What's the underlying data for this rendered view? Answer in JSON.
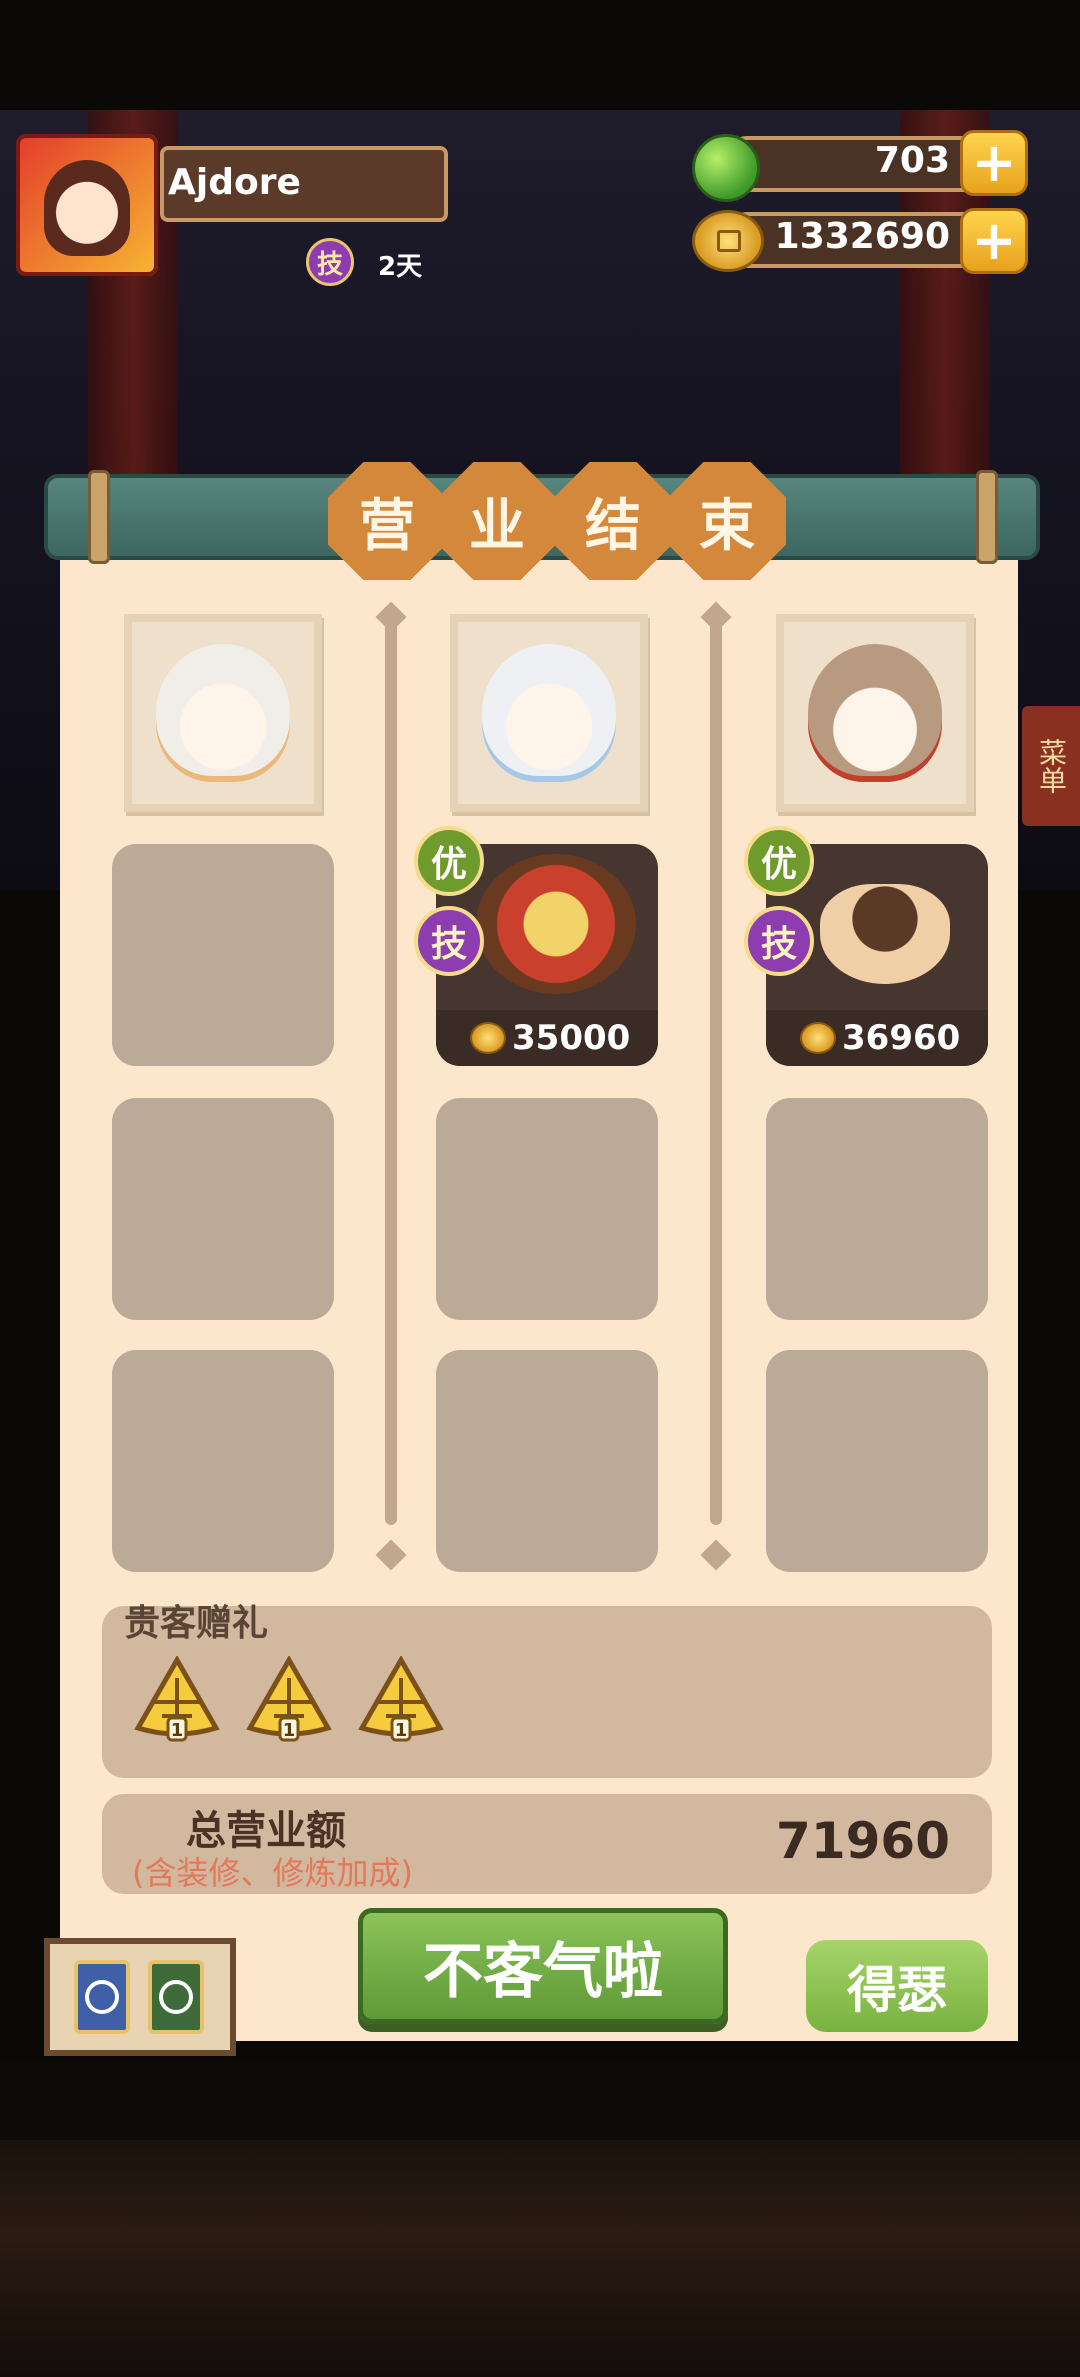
{
  "header": {
    "player_name": "Ajdore",
    "skill_badge": "技",
    "days": "2天",
    "jade_amount": "703",
    "coin_amount": "1332690",
    "plus": "+"
  },
  "title_tiles": [
    "营",
    "业",
    "结",
    "束"
  ],
  "customers": [
    {
      "portrait": "white-haired-girl-gold-crown",
      "slots": [
        null,
        null,
        null,
        null
      ]
    },
    {
      "portrait": "white-haired-girl-blue-bow",
      "slots": [
        {
          "badge_you": "优",
          "badge_ji": "技",
          "price": "35000",
          "dish": "hotpot-dish"
        },
        null,
        null
      ]
    },
    {
      "portrait": "curly-haired-man-glasses",
      "slots": [
        {
          "badge_you": "优",
          "badge_ji": "技",
          "price": "36960",
          "dish": "clay-pot-dish"
        },
        null,
        null
      ]
    }
  ],
  "gift": {
    "title": "贵客赠礼",
    "items": [
      {
        "count": "1"
      },
      {
        "count": "1"
      },
      {
        "count": "1"
      }
    ]
  },
  "total": {
    "label": "总营业额",
    "note": "(含装修、修炼加成)",
    "value": "71960"
  },
  "buttons": {
    "decline": "不客气啦",
    "accept": "得瑟"
  },
  "side_tag": "菜单",
  "colors": {
    "panel": "#fde7cc",
    "slot": "#bbaa97",
    "title_tile": "#d3883c",
    "green_button": "#6fae44",
    "skill_purple": "#8e3db0"
  }
}
